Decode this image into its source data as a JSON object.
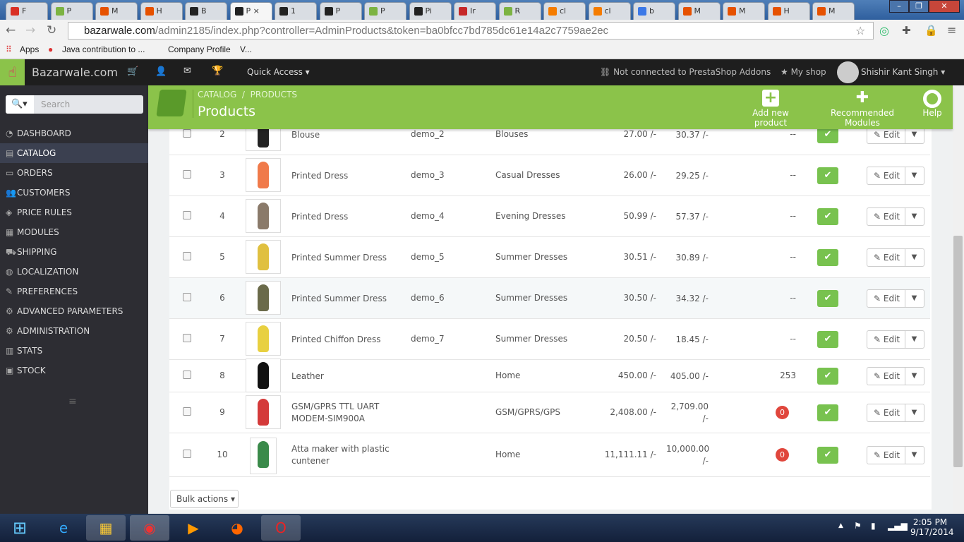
{
  "browser": {
    "tabs": [
      {
        "label": "F",
        "color": "#d93025"
      },
      {
        "label": "P",
        "color": "#7cb342"
      },
      {
        "label": "M",
        "color": "#e65100"
      },
      {
        "label": "H",
        "color": "#e65100"
      },
      {
        "label": "B",
        "color": "#222"
      },
      {
        "label": "P",
        "color": "#222",
        "active": true
      },
      {
        "label": "1",
        "color": "#222"
      },
      {
        "label": "P",
        "color": "#222"
      },
      {
        "label": "P",
        "color": "#7cb342"
      },
      {
        "label": "Pi",
        "color": "#222"
      },
      {
        "label": "Ir",
        "color": "#c62828"
      },
      {
        "label": "R",
        "color": "#7cb342"
      },
      {
        "label": "cl",
        "color": "#f57c00"
      },
      {
        "label": "cl",
        "color": "#f57c00"
      },
      {
        "label": "b",
        "color": "#3b78e7"
      },
      {
        "label": "M",
        "color": "#e65100"
      },
      {
        "label": "M",
        "color": "#e65100"
      },
      {
        "label": "H",
        "color": "#e65100"
      },
      {
        "label": "M",
        "color": "#e65100"
      }
    ],
    "url_host": "bazarwale.com",
    "url_path": "/admin2185/index.php?controller=AdminProducts&token=ba0bfcc7bd785dc61e14a2c7759ae2ec",
    "bookmarks": [
      "Apps",
      "Java contribution to ...",
      "Company Profile",
      "V..."
    ]
  },
  "admin": {
    "shop_name": "Bazarwale.com",
    "quick_access": "Quick Access",
    "addons_status": "Not connected to PrestaShop Addons",
    "my_shop": "My shop",
    "user": "Shishir Kant Singh",
    "search_placeholder": "Search"
  },
  "sidebar": [
    {
      "label": "DASHBOARD",
      "icon": "◔"
    },
    {
      "label": "CATALOG",
      "icon": "▤",
      "active": true
    },
    {
      "label": "ORDERS",
      "icon": "▭"
    },
    {
      "label": "CUSTOMERS",
      "icon": "👥"
    },
    {
      "label": "PRICE RULES",
      "icon": "◈"
    },
    {
      "label": "MODULES",
      "icon": "▦"
    },
    {
      "label": "SHIPPING",
      "icon": "⛟"
    },
    {
      "label": "LOCALIZATION",
      "icon": "◍"
    },
    {
      "label": "PREFERENCES",
      "icon": "✎"
    },
    {
      "label": "ADVANCED PARAMETERS",
      "icon": "⚙"
    },
    {
      "label": "ADMINISTRATION",
      "icon": "⚙"
    },
    {
      "label": "STATS",
      "icon": "▥"
    },
    {
      "label": "STOCK",
      "icon": "▣"
    }
  ],
  "header": {
    "breadcrumb": [
      "CATALOG",
      "PRODUCTS"
    ],
    "title": "Products",
    "actions": [
      "Add new product",
      "Recommended Modules",
      "Help"
    ]
  },
  "products": [
    {
      "id": "2",
      "name": "Blouse",
      "ref": "demo_2",
      "category": "Blouses",
      "price": "27.00 /-",
      "final": "30.37 /-",
      "qty": "--",
      "color": "#222"
    },
    {
      "id": "3",
      "name": "Printed Dress",
      "ref": "demo_3",
      "category": "Casual Dresses",
      "price": "26.00 /-",
      "final": "29.25 /-",
      "qty": "--",
      "color": "#f07a4a"
    },
    {
      "id": "4",
      "name": "Printed Dress",
      "ref": "demo_4",
      "category": "Evening Dresses",
      "price": "50.99 /-",
      "final": "57.37 /-",
      "qty": "--",
      "color": "#8a7a6a"
    },
    {
      "id": "5",
      "name": "Printed Summer Dress",
      "ref": "demo_5",
      "category": "Summer Dresses",
      "price": "30.51 /-",
      "final": "30.89 /-",
      "qty": "--",
      "color": "#e0c040"
    },
    {
      "id": "6",
      "name": "Printed Summer Dress",
      "ref": "demo_6",
      "category": "Summer Dresses",
      "price": "30.50 /-",
      "final": "34.32 /-",
      "qty": "--",
      "color": "#6a6a4a"
    },
    {
      "id": "7",
      "name": "Printed Chiffon Dress",
      "ref": "demo_7",
      "category": "Summer Dresses",
      "price": "20.50 /-",
      "final": "18.45 /-",
      "qty": "--",
      "color": "#e8d040"
    },
    {
      "id": "8",
      "name": "Leather",
      "ref": "",
      "category": "Home",
      "price": "450.00 /-",
      "final": "405.00 /-",
      "qty": "253",
      "color": "#111"
    },
    {
      "id": "9",
      "name": "GSM/GPRS TTL UART MODEM-SIM900A",
      "ref": "",
      "category": "GSM/GPRS/GPS",
      "price": "2,408.00 /-",
      "final": "2,709.00 /-",
      "qty": "0",
      "color": "#d43a3a"
    },
    {
      "id": "10",
      "name": "Atta maker with plastic cuntener",
      "ref": "",
      "category": "Home",
      "price": "11,111.11 /-",
      "final": "10,000.00 /-",
      "qty": "0",
      "color": "#3a8a4a"
    }
  ],
  "row_labels": {
    "edit": "Edit",
    "status": "✔"
  },
  "bulk_actions": "Bulk actions",
  "taskbar": {
    "time": "2:05 PM",
    "date": "9/17/2014"
  }
}
